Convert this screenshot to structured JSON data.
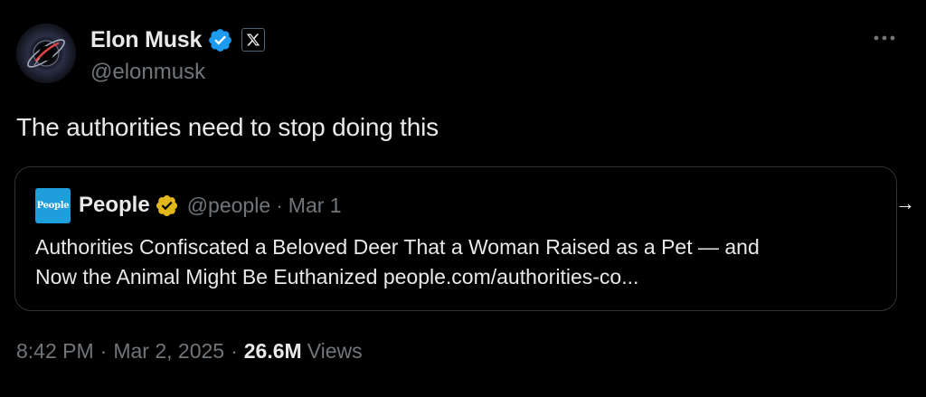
{
  "author": {
    "display_name": "Elon Musk",
    "handle": "@elonmusk",
    "verified_badge": "blue-check",
    "affiliate_badge": "x-logo-icon"
  },
  "post": {
    "text": "The authorities need to stop doing this",
    "time": "8:42 PM",
    "date": "Mar 2, 2025",
    "separator": "·",
    "views_count": "26.6M",
    "views_label": "Views"
  },
  "quote": {
    "logo_text": "People",
    "display_name": "People",
    "verified_badge": "gold-check",
    "handle": "@people",
    "separator": "·",
    "date": "Mar 1",
    "body_line_1": "Authorities Confiscated a Beloved Deer That a Woman Raised as a Pet — and",
    "body_line_2": "Now the Animal Might Be Euthanized people.com/authorities-co..."
  },
  "icons": {
    "more": "more-horizontal-icon",
    "arrow": "arrow-right-icon",
    "arrow_glyph": "→"
  },
  "colors": {
    "background": "#000000",
    "primary_text": "#e7e9ea",
    "secondary_text": "#71767b",
    "border": "#2f3336",
    "verified_blue": "#1d9bf0",
    "verified_gold": "#e2b719",
    "people_blue": "#1e9fdc"
  }
}
